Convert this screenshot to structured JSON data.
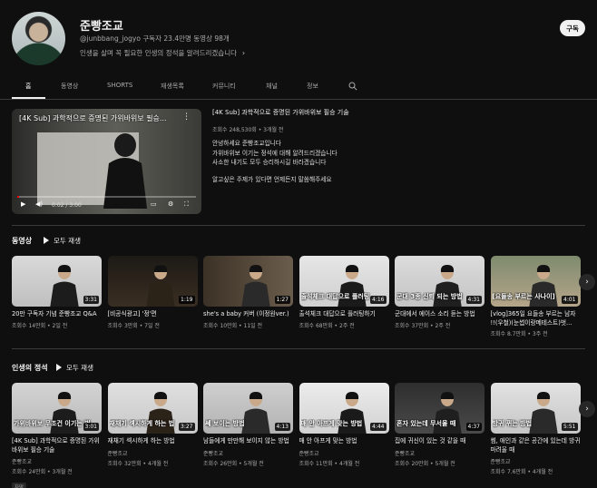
{
  "channel": {
    "name": "준빵조교",
    "meta": "@junbbang_jogyo   구독자 23.4만명  동영상 98개",
    "description": "인생을 살며 꼭 필요한 인생의 정석을 알려드리겠습니다",
    "subscribe_label": "구독"
  },
  "tabs": [
    "홈",
    "동영상",
    "SHORTS",
    "재생목록",
    "커뮤니티",
    "채널",
    "정보"
  ],
  "featured": {
    "overlay_title": "[4K Sub] 과학적으로 증명된 가위바위보 필승...",
    "title": "[4K Sub] 과학적으로 증명된 가위바위보 필승 기술",
    "meta": "조회수 248,530회 • 3개월 전",
    "time": "0:02 / 3:00",
    "progress": 0.01,
    "description": [
      "안녕하세요 준빵조교입니다",
      "가위바위보 이기는 정석에 대해 알려드리겠습니다",
      "사소한 내기도 모두 승리하시길 바라겠습니다"
    ],
    "description2": "알고싶은 주제가 있다면 언제든지 말씀해주세요"
  },
  "shelves": [
    {
      "title": "동영상",
      "play_all": "모두 재생",
      "videos": [
        {
          "title": "20만 구독자 기념 준빵조교 Q&A",
          "meta": "조회수 14만회 • 2일 전",
          "duration": "3:31",
          "caption": ""
        },
        {
          "title": "[비공식광고] '정'편",
          "meta": "조회수 3만회 • 7일 전",
          "duration": "1:19",
          "caption": ""
        },
        {
          "title": "she's a baby 커버 (이정원ver.)",
          "meta": "조회수 10만회 • 11일 전",
          "duration": "1:27",
          "caption": ""
        },
        {
          "title": "출석체크 대답으로 플러팅하기",
          "meta": "조회수 68만회 • 2주 전",
          "duration": "4:16",
          "caption": "출석체크 대답으로 플러팅"
        },
        {
          "title": "군대에서 에이스 소리 듣는 방법",
          "meta": "조회수 37만회 • 2주 전",
          "duration": "4:31",
          "caption": "군대 3종 신뢰 되는 방법"
        },
        {
          "title": "[vlog]365일 요들송 부르는 남자 !!(우철)(눈썹이랑메테스트)벗...",
          "meta": "조회수 8.7만회 • 3주 전",
          "duration": "4:01",
          "caption": "[요들송 부르는 사나이]"
        }
      ]
    },
    {
      "title": "인생의 정석",
      "play_all": "모두 재생",
      "videos": [
        {
          "title": "[4K Sub] 과학적으로 증명된 가위바위보 필승 기술",
          "channel": "준빵조교",
          "meta": "조회수 24만회 • 3개월 전",
          "duration": "3:01",
          "caption": "가위바위보 무조건 이기는 법",
          "badge": "자막"
        },
        {
          "title": "재채기 섹시하게 하는 방법",
          "channel": "준빵조교",
          "meta": "조회수 32만회 • 4개월 전",
          "duration": "3:27",
          "caption": "재채기 섹시하게 하는 법"
        },
        {
          "title": "남들에게 만만해 보이지 않는 방법",
          "channel": "준빵조교",
          "meta": "조회수 26만회 • 5개월 전",
          "duration": "4:13",
          "caption": "쎄 보이는 방법"
        },
        {
          "title": "매 안 아프게 맞는 방법",
          "channel": "준빵조교",
          "meta": "조회수 11만회 • 4개월 전",
          "duration": "4:44",
          "caption": "매 안 아프게 맞는 방법"
        },
        {
          "title": "집에 귀신이 있는 것 같을 때",
          "channel": "준빵조교",
          "meta": "조회수 20만회 • 5개월 전",
          "duration": "4:37",
          "caption": "혼자 있는데 무서울 때"
        },
        {
          "title": "썸, 애인과 같은 공간에 있는데 방귀 마려울 때",
          "channel": "준빵조교",
          "meta": "조회수 7.6만회 • 4개월 전",
          "duration": "5:51",
          "caption": "방귀 뀌는 방법"
        }
      ]
    }
  ],
  "colors": {
    "background": "#0f0f0f",
    "progress": "#ff0000",
    "text_secondary": "#aaaaaa"
  },
  "icons": [
    "search-icon",
    "more-vert-icon",
    "play-icon",
    "volume-icon",
    "settings-icon",
    "fullscreen-icon",
    "chevron-right-icon"
  ]
}
